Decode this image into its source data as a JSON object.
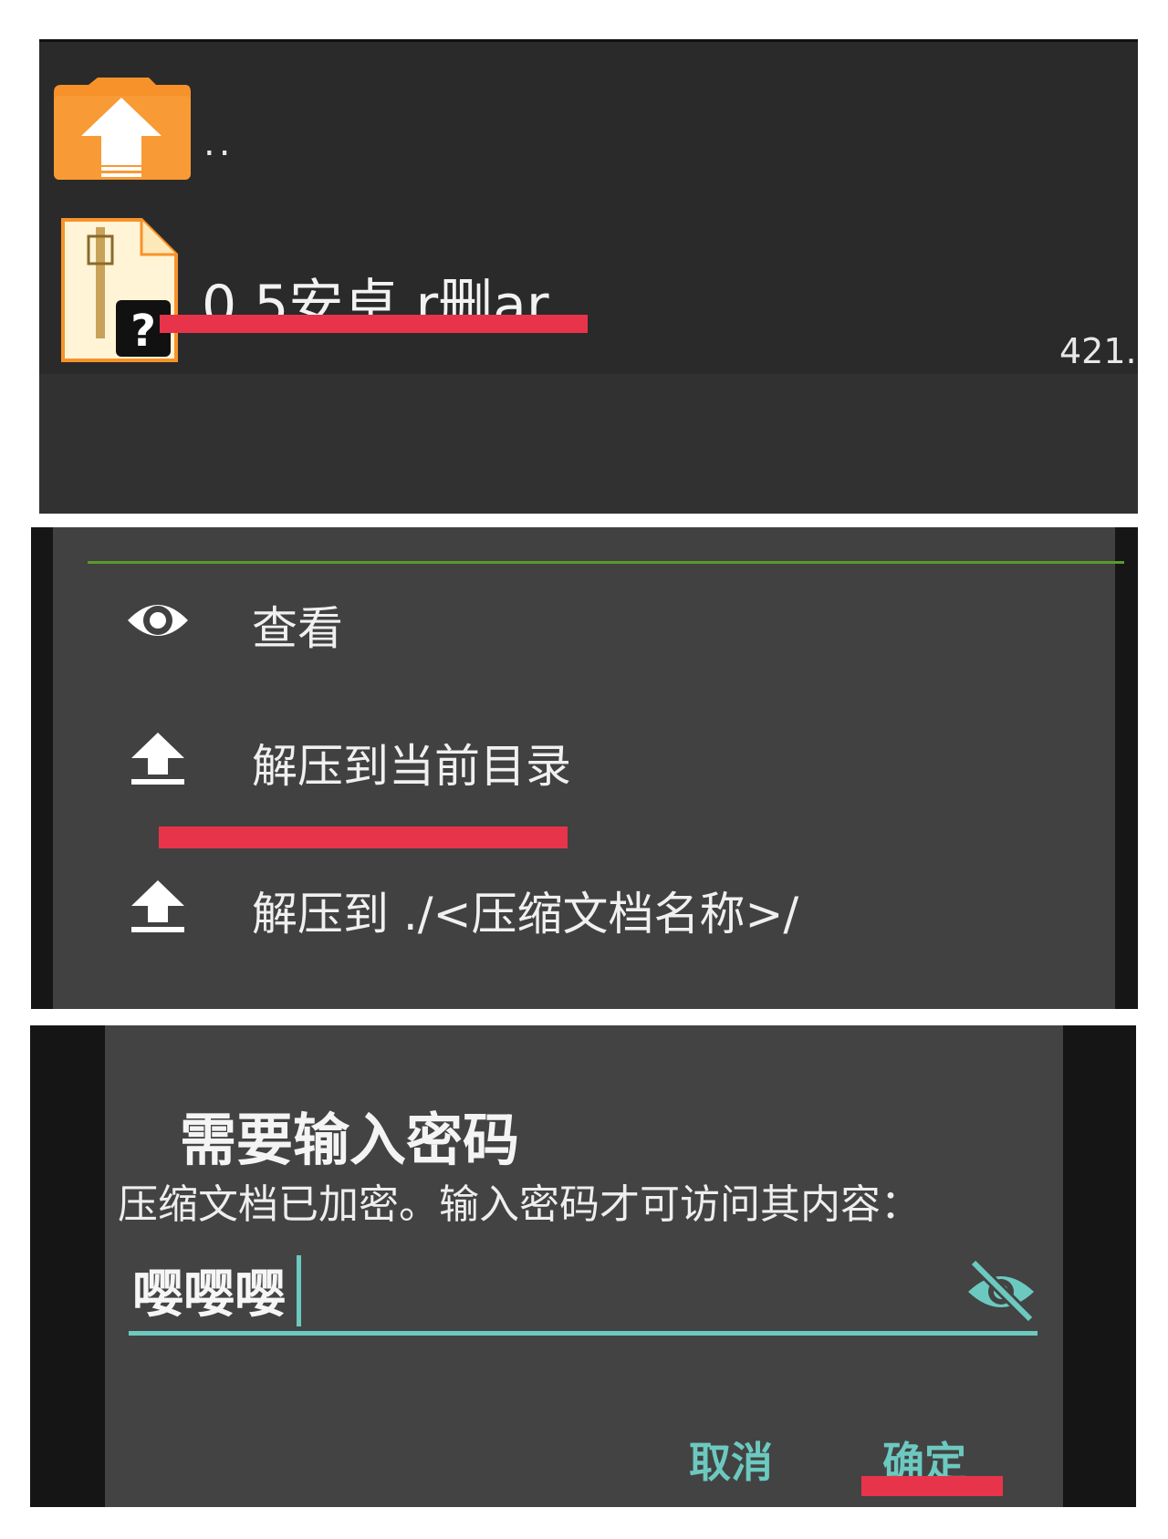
{
  "file_list": {
    "parent_folder_label": "..",
    "file": {
      "name": "0.5安卓.r删ar",
      "size": "421."
    }
  },
  "context_menu": {
    "items": [
      {
        "icon": "eye-icon",
        "label": "查看"
      },
      {
        "icon": "upload-icon",
        "label": "解压到当前目录"
      },
      {
        "icon": "upload-icon",
        "label": "解压到 ./<压缩文档名称>/"
      }
    ]
  },
  "password_dialog": {
    "title": "需要输入密码",
    "message": "压缩文档已加密。输入密码才可访问其内容：",
    "password_value": "嘤嘤嘤",
    "visibility_icon": "visibility-off-icon",
    "cancel_label": "取消",
    "confirm_label": "确定"
  },
  "colors": {
    "accent": "#6cc9c0",
    "annotation_red": "#e8344a",
    "folder_orange": "#f7922a",
    "divider_green": "#5a9a2a"
  }
}
